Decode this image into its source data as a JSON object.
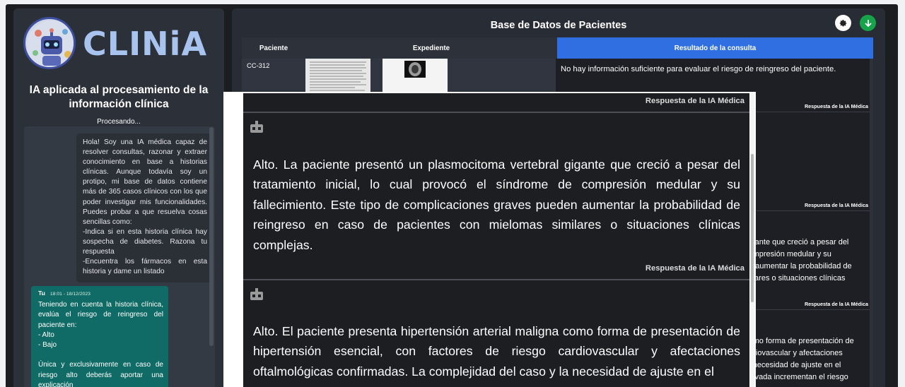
{
  "sidebar": {
    "logo_text": "CLINiA",
    "title": "IA aplicada al procesamiento de la información clínica",
    "processing": "Procesando...",
    "bot_message": "Hola! Soy una IA médica capaz de resolver consultas, razonar y extraer conocimiento en base a historias clínicas. Aunque todavía soy un protipo, mi base de datos contiene más de 365 casos clínicos con los que poder investigar mis funcionalidades. Puedes probar a que resuelva cosas sencillas como:\n-Indica si en esta historia clínica hay sospecha de diabetes. Razona tu respuesta\n-Encuentra los fármacos en esta historia y dame un listado",
    "user_message": {
      "author": "Tu",
      "time": "18:01 - 18/12/2023",
      "text": "Teniendo en cuenta la historia clínica, evalúa el riesgo de reingreso del paciente en:\n- Alto\n- Bajo\n\nÚnica y exclusivamente en caso de riesgo alto deberás aportar una explicación"
    }
  },
  "main": {
    "title": "Base de Datos de Pacientes",
    "columns": [
      "Paciente",
      "Expediente",
      "Resultado de la consulta"
    ],
    "rows": [
      {
        "patient": "CC-312",
        "result": "No hay información suficiente para evaluar el riesgo de reingreso del paciente."
      }
    ],
    "row_label": "Respuesta de la IA Médica",
    "peek_2": [
      "gigante que creció a pesar del",
      "compresión medular y su",
      "en aumentar la probabilidad de",
      "milares o situaciones clínicas"
    ],
    "peek_3": [
      "como forma de presentación de",
      "ardiovascular y afectaciones",
      "la necesidad de ajuste en el",
      "elevada incrementan el riesgo"
    ]
  },
  "overlay": {
    "label": "Respuesta de la IA Médica",
    "response_1": "Alto. La paciente presentó un plasmocitoma vertebral gigante que creció a pesar del tratamiento inicial, lo cual provocó el síndrome de compresión medular y su fallecimiento. Este tipo de complicaciones graves pueden aumentar la probabilidad de reingreso en caso de pacientes con mielomas similares o situaciones clínicas complejas.",
    "response_2": "Alto. El paciente presenta hipertensión arterial maligna como forma de presentación de hipertensión esencial, con factores de riesgo cardiovascular y afectaciones oftalmológicas confirmadas. La complejidad del caso y la necesidad de ajuste en el"
  },
  "icons": {
    "settings": "gear-icon",
    "download": "arrow-down-icon",
    "bot": "robot-icon"
  },
  "colors": {
    "accent_blue": "#2f6fe2",
    "user_bubble": "#106b66",
    "download_green": "#16a34a"
  }
}
